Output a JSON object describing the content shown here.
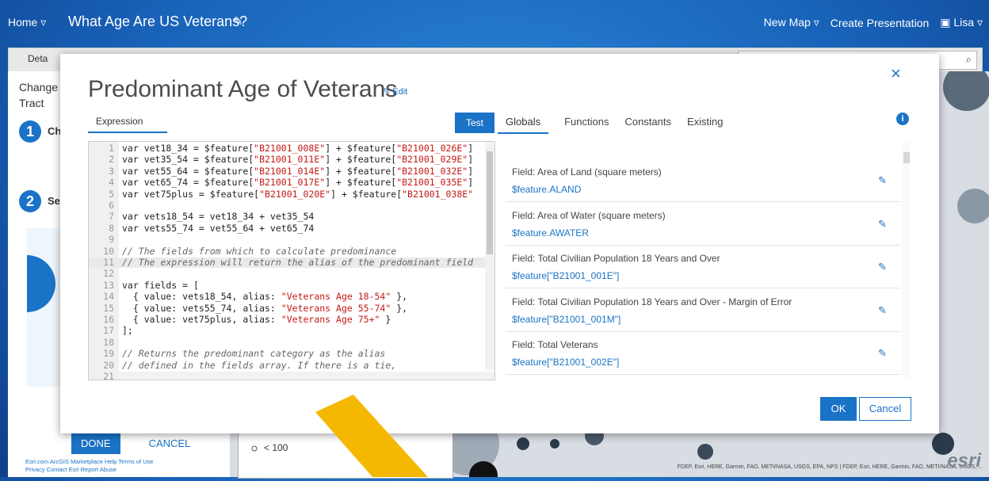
{
  "topbar": {
    "home": "Home ▿",
    "map_title": "What Age Are US Veterans?",
    "new_map": "New Map ▿",
    "create_presentation": "Create Presentation",
    "user": "Lisa ▿"
  },
  "toolbar": {
    "details": "Deta"
  },
  "left_panel": {
    "line1": "Change",
    "line2": "Tract",
    "step1": "1",
    "step1_text": "Ch",
    "step2": "2",
    "step2_text": "Sel",
    "done": "DONE",
    "cancel": "CANCEL",
    "footer1": "Esri.com   ArcGIS Marketplace   Help   Terms of Use",
    "footer2": "Privacy   Contact Esri   Report Abuse"
  },
  "map": {
    "legend_text": "< 100",
    "attribution": "FDEP, Esri, HERE, Garmin, FAO, METI/NASA, USGS, EPA, NPS | FDEP, Esri, HERE, Garmin, FAO, METI/NASA, USGS, ...",
    "esri_logo": "esri"
  },
  "dialog": {
    "title": "Predominant Age of Veterans",
    "edit": "Edit",
    "close": "×",
    "expression_tab": "Expression",
    "test_button": "Test",
    "tabs": [
      "Globals",
      "Functions",
      "Constants",
      "Existing"
    ],
    "info": "i",
    "ok": "OK",
    "cancel": "Cancel",
    "code_lines": [
      {
        "n": "1",
        "t": "var vet18_34 = $feature[\"B21001_008E\"] + $feature[\"B21001_026E\"]"
      },
      {
        "n": "2",
        "t": "var vet35_54 = $feature[\"B21001_011E\"] + $feature[\"B21001_029E\"]"
      },
      {
        "n": "3",
        "t": "var vet55_64 = $feature[\"B21001_014E\"] + $feature[\"B21001_032E\"]"
      },
      {
        "n": "4",
        "t": "var vet65_74 = $feature[\"B21001_017E\"] + $feature[\"B21001_035E\"]"
      },
      {
        "n": "5",
        "t": "var vet75plus = $feature[\"B21001_020E\"] + $feature[\"B21001_038E\""
      },
      {
        "n": "6",
        "t": ""
      },
      {
        "n": "7",
        "t": "var vets18_54 = vet18_34 + vet35_54"
      },
      {
        "n": "8",
        "t": "var vets55_74 = vet55_64 + vet65_74"
      },
      {
        "n": "9",
        "t": ""
      },
      {
        "n": "10",
        "t": "// The fields from which to calculate predominance"
      },
      {
        "n": "11",
        "t": "// The expression will return the alias of the predominant field"
      },
      {
        "n": "12",
        "t": ""
      },
      {
        "n": "13",
        "t": "var fields = ["
      },
      {
        "n": "14",
        "t": "  { value: vets18_54, alias: \"Veterans Age 18-54\" },"
      },
      {
        "n": "15",
        "t": "  { value: vets55_74, alias: \"Veterans Age 55-74\" },"
      },
      {
        "n": "16",
        "t": "  { value: vet75plus, alias: \"Veterans Age 75+\" }"
      },
      {
        "n": "17",
        "t": "];"
      },
      {
        "n": "18",
        "t": ""
      },
      {
        "n": "19",
        "t": "// Returns the predominant category as the alias"
      },
      {
        "n": "20",
        "t": "// defined in the fields array. If there is a tie,"
      },
      {
        "n": "21",
        "t": ""
      }
    ],
    "globals": [
      {
        "label": "Field: Area of Land (square meters)",
        "expr": "$feature.ALAND"
      },
      {
        "label": "Field: Area of Water (square meters)",
        "expr": "$feature.AWATER"
      },
      {
        "label": "Field: Total Civilian Population 18 Years and Over",
        "expr": "$feature[\"B21001_001E\"]"
      },
      {
        "label": "Field: Total Civilian Population 18 Years and Over - Margin of Error",
        "expr": "$feature[\"B21001_001M\"]"
      },
      {
        "label": "Field: Total Veterans",
        "expr": "$feature[\"B21001_002E\"]"
      }
    ]
  },
  "colors": {
    "accent": "#1a73c6",
    "arrow": "#f5b800"
  }
}
